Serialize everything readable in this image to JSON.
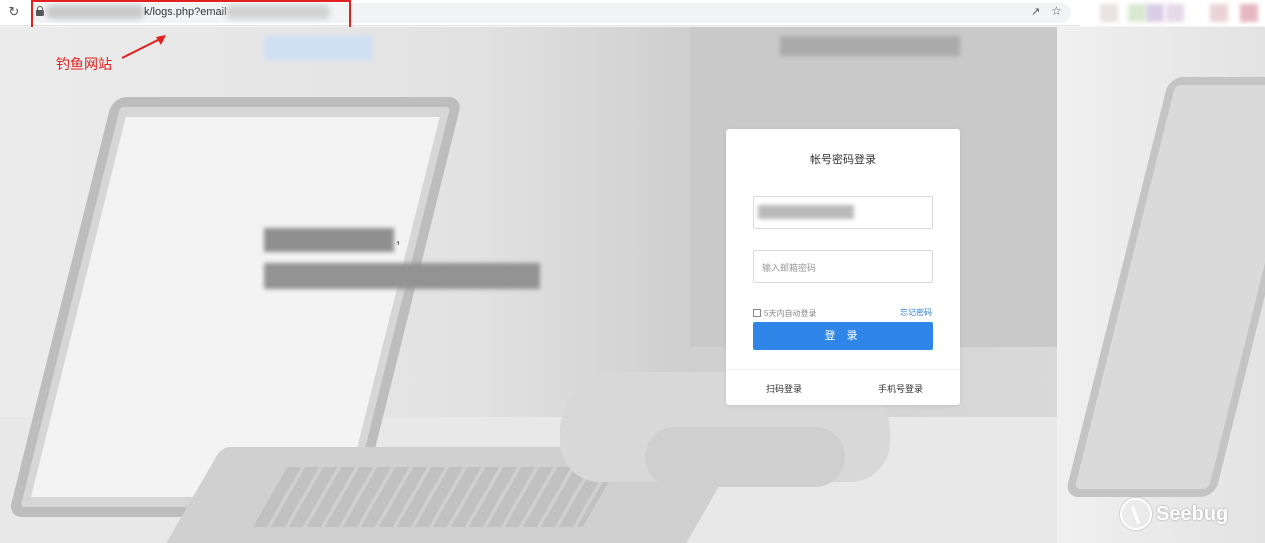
{
  "browser": {
    "url_visible": "k/logs.php?email",
    "icons": [
      "reload-icon",
      "lock-icon",
      "share-icon",
      "star-icon"
    ]
  },
  "annotation": {
    "label": "钓鱼网站",
    "color": "#e32020"
  },
  "login": {
    "title": "帐号密码登录",
    "password_placeholder": "输入邮箱密码",
    "remember_label": "5天内自动登录",
    "forgot_label": "忘记密码",
    "login_button": "登 录",
    "qr_login": "扫码登录",
    "phone_login": "手机号登录",
    "accent": "#2f86e8"
  },
  "slogan": {
    "comma": ","
  },
  "watermark": {
    "text": "Seebug"
  }
}
